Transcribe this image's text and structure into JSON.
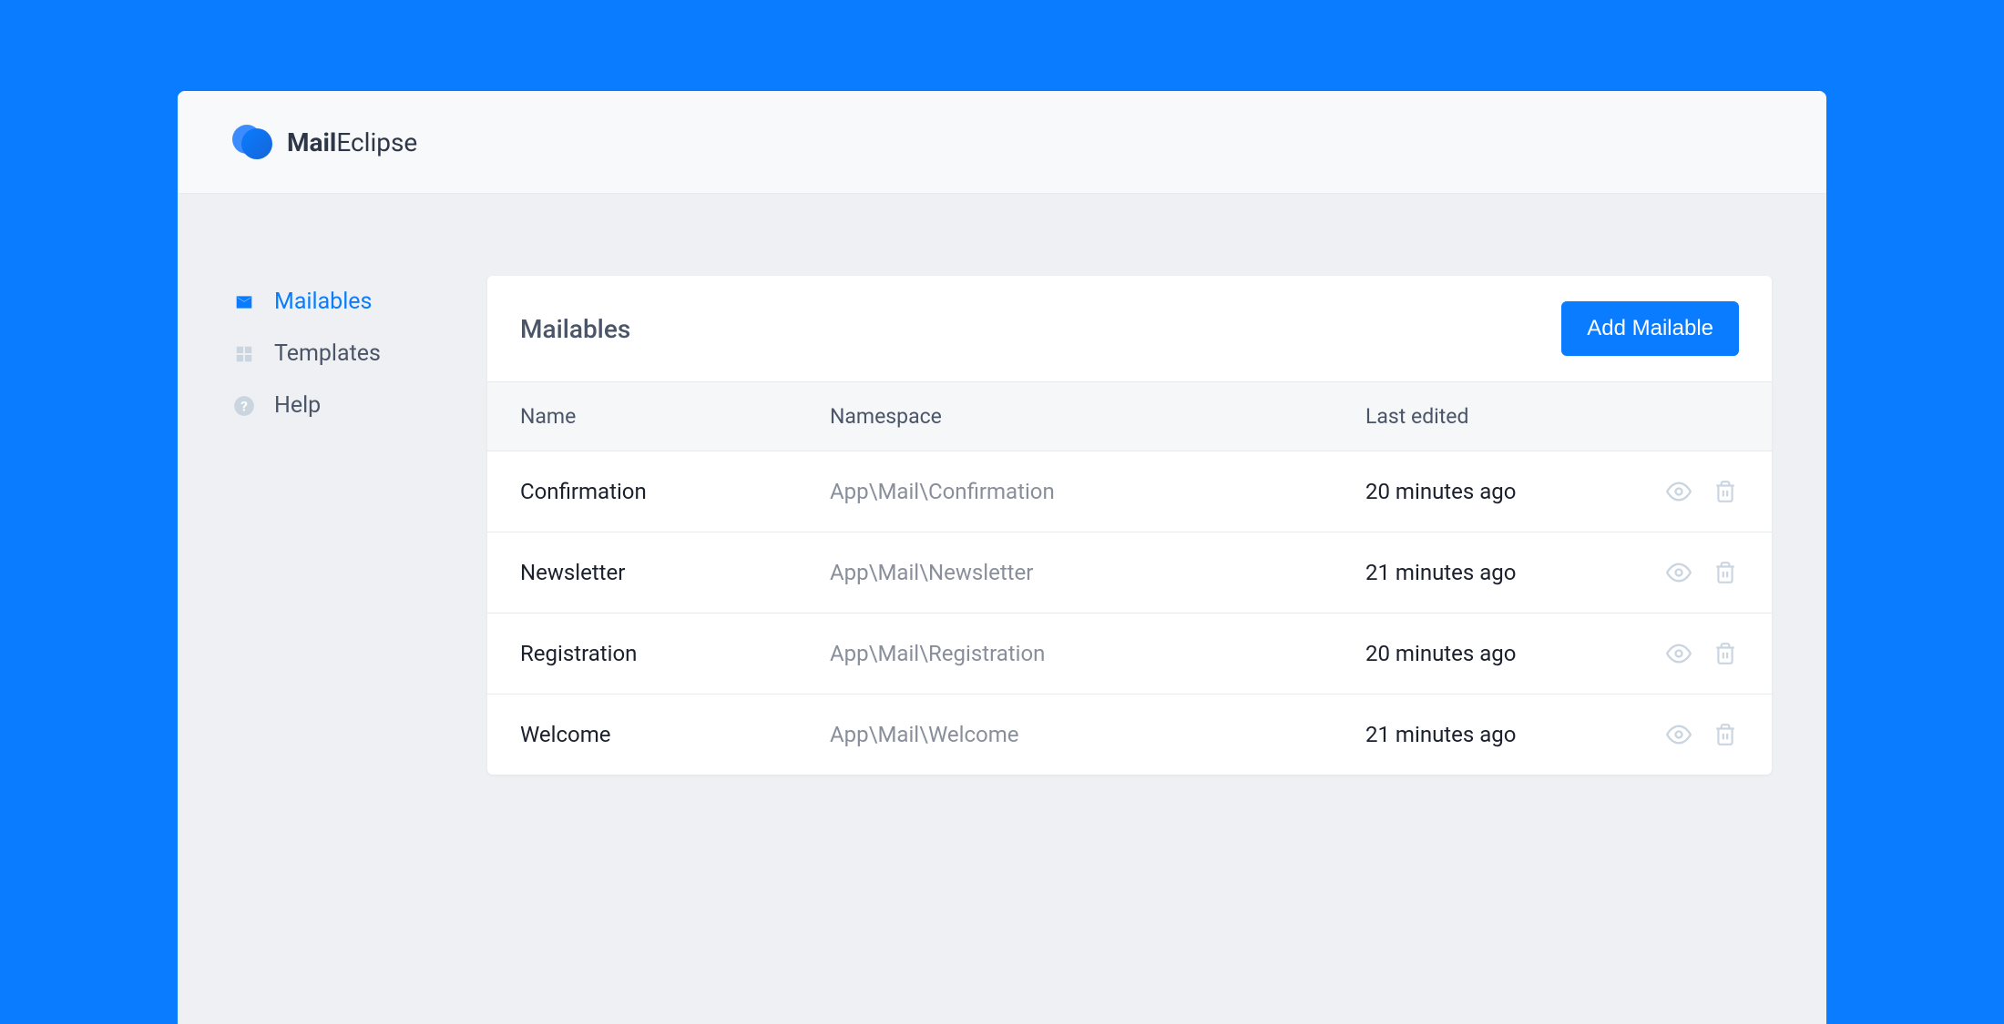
{
  "brand": {
    "name_bold": "Mail",
    "name_regular": "Eclipse"
  },
  "sidebar": {
    "items": [
      {
        "label": "Mailables",
        "icon": "mail-icon",
        "active": true
      },
      {
        "label": "Templates",
        "icon": "grid-icon",
        "active": false
      },
      {
        "label": "Help",
        "icon": "help-icon",
        "active": false
      }
    ]
  },
  "panel": {
    "title": "Mailables",
    "add_button_label": "Add Mailable",
    "columns": {
      "name": "Name",
      "namespace": "Namespace",
      "last_edited": "Last edited"
    },
    "rows": [
      {
        "name": "Confirmation",
        "namespace": "App\\Mail\\Confirmation",
        "last_edited": "20 minutes ago"
      },
      {
        "name": "Newsletter",
        "namespace": "App\\Mail\\Newsletter",
        "last_edited": "21 minutes ago"
      },
      {
        "name": "Registration",
        "namespace": "App\\Mail\\Registration",
        "last_edited": "20 minutes ago"
      },
      {
        "name": "Welcome",
        "namespace": "App\\Mail\\Welcome",
        "last_edited": "21 minutes ago"
      }
    ]
  },
  "colors": {
    "primary": "#0a7cff",
    "background": "#eef0f3"
  }
}
